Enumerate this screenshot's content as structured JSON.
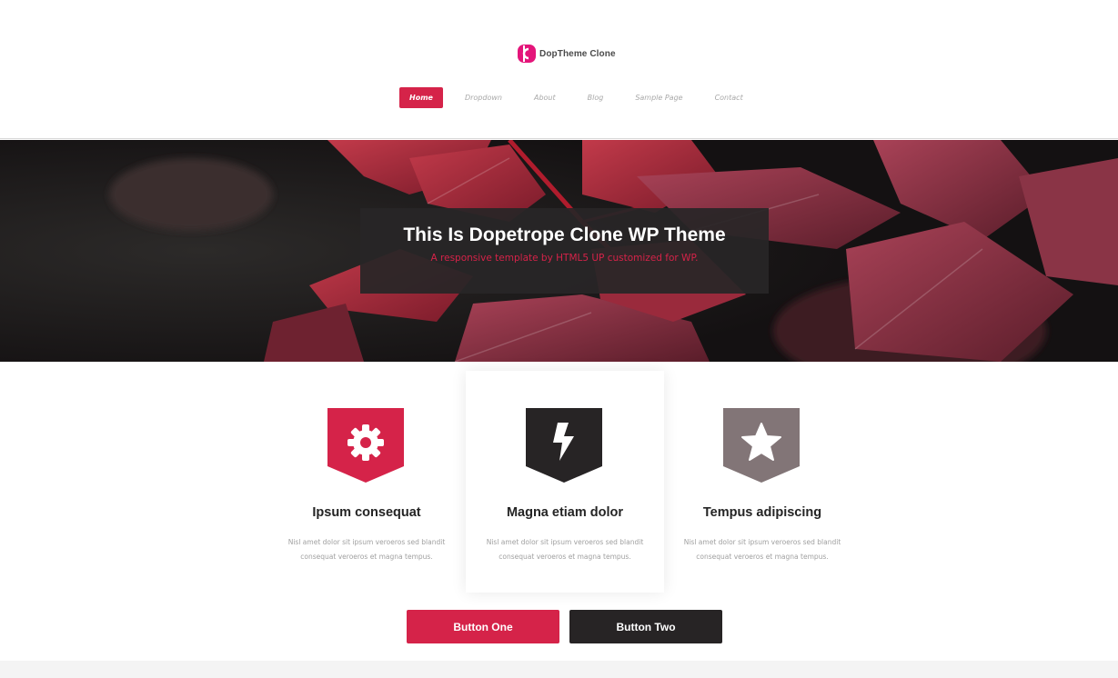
{
  "site": {
    "logo_text": "DopTheme Clone",
    "colors": {
      "accent": "#d52349",
      "dark": "#272425",
      "muted": "#827577"
    }
  },
  "nav": {
    "items": [
      {
        "label": "Home",
        "active": true
      },
      {
        "label": "Dropdown",
        "active": false
      },
      {
        "label": "About",
        "active": false
      },
      {
        "label": "Blog",
        "active": false
      },
      {
        "label": "Sample Page",
        "active": false
      },
      {
        "label": "Contact",
        "active": false
      }
    ]
  },
  "banner": {
    "title": "This Is Dopetrope Clone WP Theme",
    "subtitle": "A responsive template by HTML5 UP customized for WP."
  },
  "features": [
    {
      "icon": "gear-icon",
      "title": "Ipsum consequat",
      "desc_line1": "Nisl amet dolor sit ipsum veroeros sed blandit",
      "desc_line2": "consequat veroeros et magna tempus."
    },
    {
      "icon": "lightning-icon",
      "title": "Magna etiam dolor",
      "desc_line1": "Nisl amet dolor sit ipsum veroeros sed blandit",
      "desc_line2": "consequat veroeros et magna tempus."
    },
    {
      "icon": "star-icon",
      "title": "Tempus adipiscing",
      "desc_line1": "Nisl amet dolor sit ipsum veroeros sed blandit",
      "desc_line2": "consequat veroeros et magna tempus."
    }
  ],
  "buttons": {
    "one_label": "Button One",
    "two_label": "Button Two"
  }
}
